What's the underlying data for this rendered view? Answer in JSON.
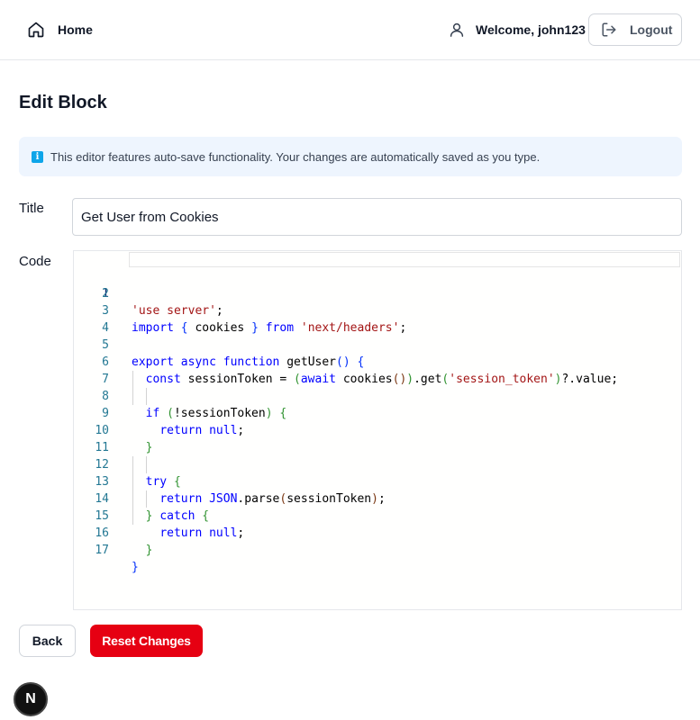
{
  "header": {
    "home_label": "Home",
    "welcome_label": "Welcome, john123",
    "logout_label": "Logout"
  },
  "page": {
    "title": "Edit Block",
    "info_text": "This editor features auto-save functionality. Your changes are automatically saved as you type."
  },
  "form": {
    "title_label": "Title",
    "title_value": "Get User from Cookies",
    "code_label": "Code"
  },
  "code": {
    "active_line": 1,
    "lines": [
      "'use server';",
      "",
      "import { cookies } from 'next/headers';",
      "",
      "export async function getUser() {",
      "  const sessionToken = (await cookies()).get('session_token')?.value;",
      "",
      "  if (!sessionToken) {",
      "    return null;",
      "  }",
      "",
      "  try {",
      "    return JSON.parse(sessionToken);",
      "  } catch {",
      "    return null;",
      "  }",
      "}"
    ]
  },
  "actions": {
    "back_label": "Back",
    "reset_label": "Reset Changes"
  },
  "dev_badge": {
    "letter": "N"
  },
  "colors": {
    "primary_red": "#e60012",
    "info_bg": "#eef5fe",
    "info_icon": "#0ea5e9"
  }
}
